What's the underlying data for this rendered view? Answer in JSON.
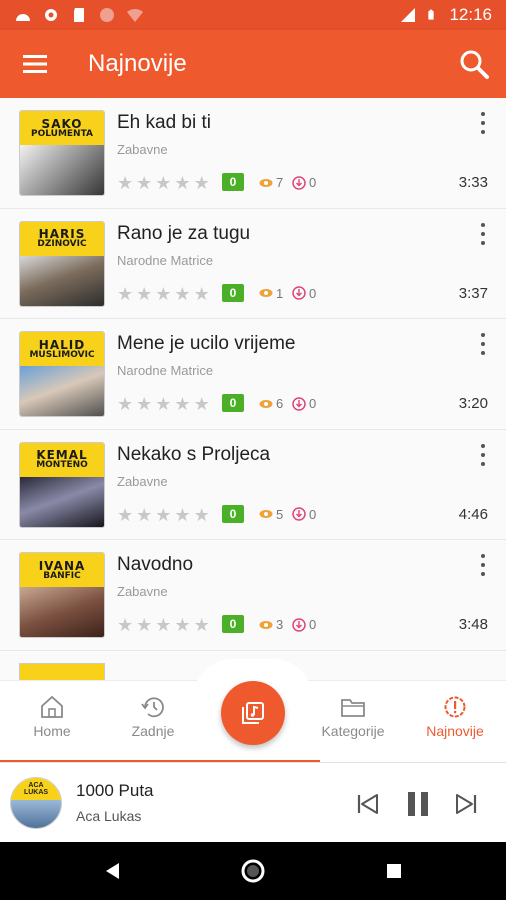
{
  "status_bar": {
    "time": "12:16"
  },
  "app_bar": {
    "title": "Najnovije"
  },
  "songs": [
    {
      "title": "Eh kad bi ti",
      "category": "Zabavne",
      "rating": "0",
      "views": "7",
      "downloads": "0",
      "duration": "3:33",
      "thumb_line1": "SAKO",
      "thumb_line2": "POLUMENTA"
    },
    {
      "title": "Rano je za tugu",
      "category": "Narodne Matrice",
      "rating": "0",
      "views": "1",
      "downloads": "0",
      "duration": "3:37",
      "thumb_line1": "HARIS",
      "thumb_line2": "DZINOVIC"
    },
    {
      "title": "Mene je ucilo vrijeme",
      "category": "Narodne Matrice",
      "rating": "0",
      "views": "6",
      "downloads": "0",
      "duration": "3:20",
      "thumb_line1": "HALID",
      "thumb_line2": "MUSLIMOVIC"
    },
    {
      "title": "Nekako s Proljeca",
      "category": "Zabavne",
      "rating": "0",
      "views": "5",
      "downloads": "0",
      "duration": "4:46",
      "thumb_line1": "KEMAL",
      "thumb_line2": "MONTENO"
    },
    {
      "title": "Navodno",
      "category": "Zabavne",
      "rating": "0",
      "views": "3",
      "downloads": "0",
      "duration": "3:48",
      "thumb_line1": "IVANA",
      "thumb_line2": "BANFIC"
    }
  ],
  "bottom_nav": {
    "home": "Home",
    "recent": "Zadnje",
    "categories": "Kategorije",
    "newest": "Najnovije"
  },
  "player": {
    "title": "1000 Puta",
    "artist": "Aca Lukas",
    "art_line1": "ACA",
    "art_line2": "LUKAS"
  },
  "colors": {
    "accent": "#ee5a2e",
    "rating_bg": "#4caf28",
    "thumb_bg": "#f7d11a"
  }
}
